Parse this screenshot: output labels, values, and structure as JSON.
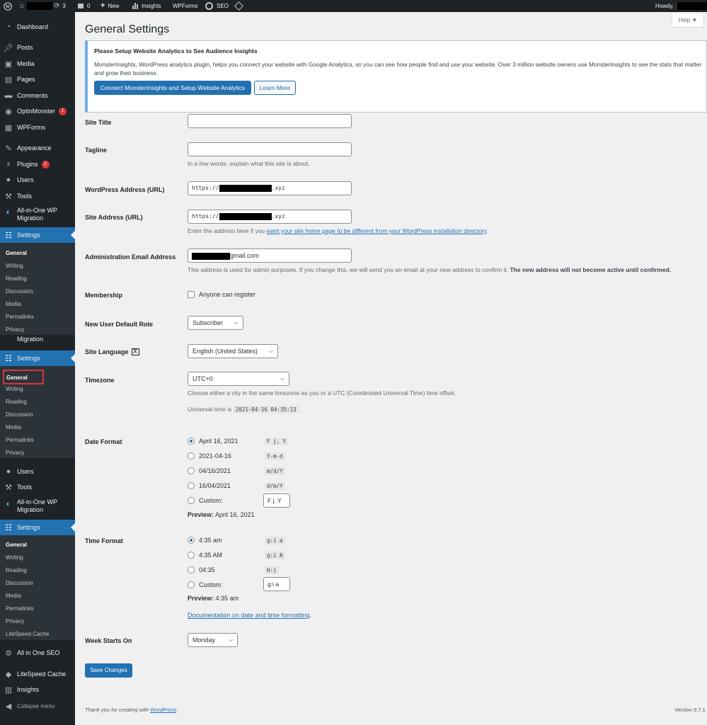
{
  "adminbar": {
    "updates_count": "3",
    "comments_count": "0",
    "new_label": "New",
    "insights_label": "Insights",
    "wpforms_label": "WPForms",
    "seo_label": "SEO",
    "howdy_label": "Howdy,"
  },
  "sidebar": {
    "dashboard": "Dashboard",
    "posts": "Posts",
    "media": "Media",
    "pages": "Pages",
    "comments": "Comments",
    "optinmonster": "OptinMonster",
    "optinmonster_badge": "1",
    "wpforms": "WPForms",
    "appearance": "Appearance",
    "plugins": "Plugins",
    "plugins_badge": "2",
    "users": "Users",
    "tools": "Tools",
    "migration_line1": "All-in-One WP",
    "migration_line2": "Migration",
    "settings": "Settings",
    "sub": {
      "general": "General",
      "writing": "Writing",
      "reading": "Reading",
      "discussion": "Discussion",
      "media": "Media",
      "permalinks": "Permalinks",
      "privacy": "Privacy",
      "litespeed_cache": "LiteSpeed Cache"
    },
    "all_in_one_seo": "All in One SEO",
    "litespeed_cache": "LiteSpeed Cache",
    "insights": "Insights",
    "collapse_menu": "Collapse menu"
  },
  "help_label": "Help",
  "page_title": "General Settings",
  "notice": {
    "title": "Please Setup Website Analytics to See Audience Insights",
    "body": "MonsterInsights, WordPress analytics plugin, helps you connect your website with Google Analytics, so you can see how people find and use your website. Over 3 million website owners use MonsterInsights to see the stats that matter and grow their business.",
    "connect_button": "Connect MonsterInsights and Setup Website Analytics",
    "learn_more_button": "Learn More"
  },
  "fields": {
    "site_title_label": "Site Title",
    "site_title_value": "",
    "tagline_label": "Tagline",
    "tagline_desc": "In a few words, explain what this site is about.",
    "wp_address_label": "WordPress Address (URL)",
    "wp_address_prefix": "https://",
    "wp_address_suffix": ".xyz",
    "site_address_label": "Site Address (URL)",
    "site_address_prefix": "https://",
    "site_address_suffix": ".xyz",
    "site_address_desc_before": "Enter the address here if you ",
    "site_address_desc_link": "want your site home page to be different from your WordPress installation directory",
    "site_address_desc_after": ".",
    "admin_email_label": "Administration Email Address",
    "admin_email_suffix": "gmail.com",
    "admin_email_desc": "This address is used for admin purposes. If you change this, we will send you an email at your new address to confirm it.",
    "admin_email_desc_bold": "The new address will not become active until confirmed.",
    "membership_label": "Membership",
    "membership_checkbox": "Anyone can register",
    "default_role_label": "New User Default Role",
    "default_role_value": "Subscriber",
    "language_label": "Site Language",
    "language_value": "English (United States)",
    "timezone_label": "Timezone",
    "timezone_value": "UTC+0",
    "timezone_desc": "Choose either a city in the same timezone as you or a UTC (Coordinated Universal Time) time offset.",
    "universal_time_label": "Universal time is",
    "universal_time_value": "2021-04-16 04:35:13",
    "universal_time_end": ".",
    "date_format_label": "Date Format",
    "date_options": [
      {
        "label": "April 16, 2021",
        "code": "F j, Y"
      },
      {
        "label": "2021-04-16",
        "code": "Y-m-d"
      },
      {
        "label": "04/16/2021",
        "code": "m/d/Y"
      },
      {
        "label": "16/04/2021",
        "code": "d/m/Y"
      },
      {
        "label": "Custom:",
        "code": "F j, Y"
      }
    ],
    "date_preview_label": "Preview:",
    "date_preview_value": "April 16, 2021",
    "time_format_label": "Time Format",
    "time_options": [
      {
        "label": "4:35 am",
        "code": "g:i a"
      },
      {
        "label": "4:35 AM",
        "code": "g:i A"
      },
      {
        "label": "04:35",
        "code": "H:i"
      },
      {
        "label": "Custom:",
        "code": "g:i a"
      }
    ],
    "time_preview_label": "Preview:",
    "time_preview_value": "4:35 am",
    "doc_link": "Documentation on date and time formatting",
    "doc_link_end": ".",
    "week_starts_label": "Week Starts On",
    "week_starts_value": "Monday"
  },
  "save_button": "Save Changes",
  "footer": {
    "thanks_before": "Thank you for creating with ",
    "thanks_link": "WordPress",
    "thanks_after": ".",
    "version": "Version 5.7.1"
  }
}
